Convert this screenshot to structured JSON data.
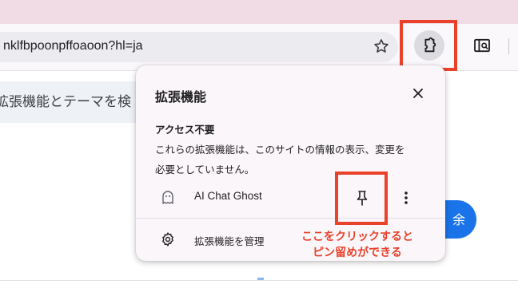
{
  "browser": {
    "omnibox_url": "nklfbpoonpffoaoon?hl=ja",
    "icons": {
      "bookmark": "star-icon",
      "extensions": "puzzle-icon",
      "side_panel": "side-panel-search-icon"
    }
  },
  "page": {
    "chip_text": "拡張機能とテーマを検",
    "button_text": "余"
  },
  "popup": {
    "title": "拡張機能",
    "close_icon": "close-icon",
    "section_heading": "アクセス不要",
    "section_description_line1": "これらの拡張機能は、このサイトの情報の表示、変更を",
    "section_description_line2": "必要としていません。",
    "extension": {
      "name": "AI Chat Ghost",
      "icon": "ghost-icon",
      "pin_icon": "pin-icon",
      "more_icon": "more-vertical-icon"
    },
    "manage_label": "拡張機能を管理",
    "manage_icon": "gear-icon"
  },
  "annotation": {
    "line1": "ここをクリックすると",
    "line2": "ピン留めができる",
    "color": "#e8422b"
  },
  "colors": {
    "tabstrip": "#f1dbe5",
    "popup_bg": "#fbf6fa",
    "accent_blue": "#1a73e8",
    "highlight_red": "#e8422b"
  }
}
